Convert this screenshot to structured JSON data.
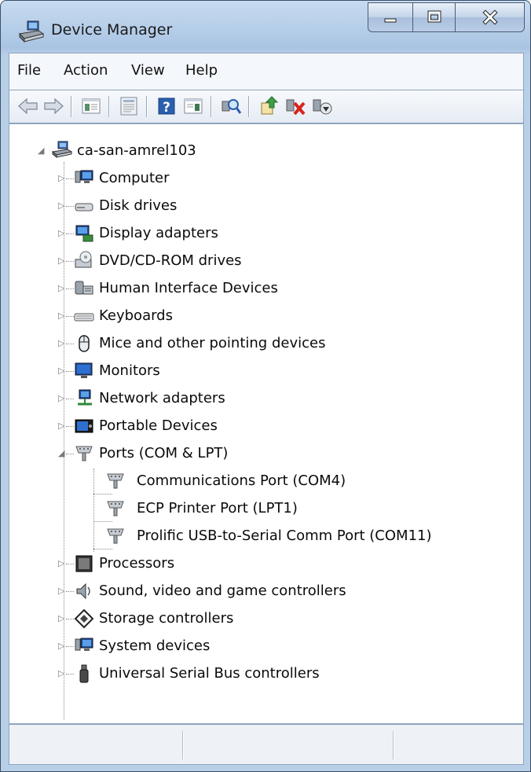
{
  "window": {
    "title": "Device Manager",
    "caption_buttons": {
      "minimize": "minimize",
      "maximize": "maximize",
      "close": "close"
    }
  },
  "menu": [
    "File",
    "Action",
    "View",
    "Help"
  ],
  "toolbar": {
    "buttons": [
      "back-icon",
      "forward-icon",
      "show-hide-tree-icon",
      "properties-icon",
      "help-icon",
      "action-pane-icon",
      "scan-hardware-icon",
      "update-driver-icon",
      "uninstall-icon",
      "disable-icon"
    ]
  },
  "tree": {
    "root": "ca-san-amrel103",
    "categories": [
      {
        "label": "Computer",
        "icon": "computer-icon",
        "expanded": false
      },
      {
        "label": "Disk drives",
        "icon": "disk-drive-icon",
        "expanded": false
      },
      {
        "label": "Display adapters",
        "icon": "display-adapter-icon",
        "expanded": false
      },
      {
        "label": "DVD/CD-ROM drives",
        "icon": "dvd-drive-icon",
        "expanded": false
      },
      {
        "label": "Human Interface Devices",
        "icon": "hid-icon",
        "expanded": false
      },
      {
        "label": "Keyboards",
        "icon": "keyboard-icon",
        "expanded": false
      },
      {
        "label": "Mice and other pointing devices",
        "icon": "mouse-icon",
        "expanded": false
      },
      {
        "label": "Monitors",
        "icon": "monitor-icon",
        "expanded": false
      },
      {
        "label": "Network adapters",
        "icon": "network-adapter-icon",
        "expanded": false
      },
      {
        "label": "Portable Devices",
        "icon": "portable-device-icon",
        "expanded": false
      },
      {
        "label": "Ports (COM & LPT)",
        "icon": "port-icon",
        "expanded": true,
        "children": [
          "Communications Port (COM4)",
          "ECP Printer Port (LPT1)",
          "Prolific USB-to-Serial Comm Port (COM11)"
        ]
      },
      {
        "label": "Processors",
        "icon": "processor-icon",
        "expanded": false
      },
      {
        "label": "Sound, video and game controllers",
        "icon": "sound-icon",
        "expanded": false
      },
      {
        "label": "Storage controllers",
        "icon": "storage-controller-icon",
        "expanded": false
      },
      {
        "label": "System devices",
        "icon": "system-devices-icon",
        "expanded": false
      },
      {
        "label": "Universal Serial Bus controllers",
        "icon": "usb-icon",
        "expanded": false
      }
    ]
  },
  "statusbar": {
    "cells": [
      "",
      "",
      ""
    ]
  }
}
